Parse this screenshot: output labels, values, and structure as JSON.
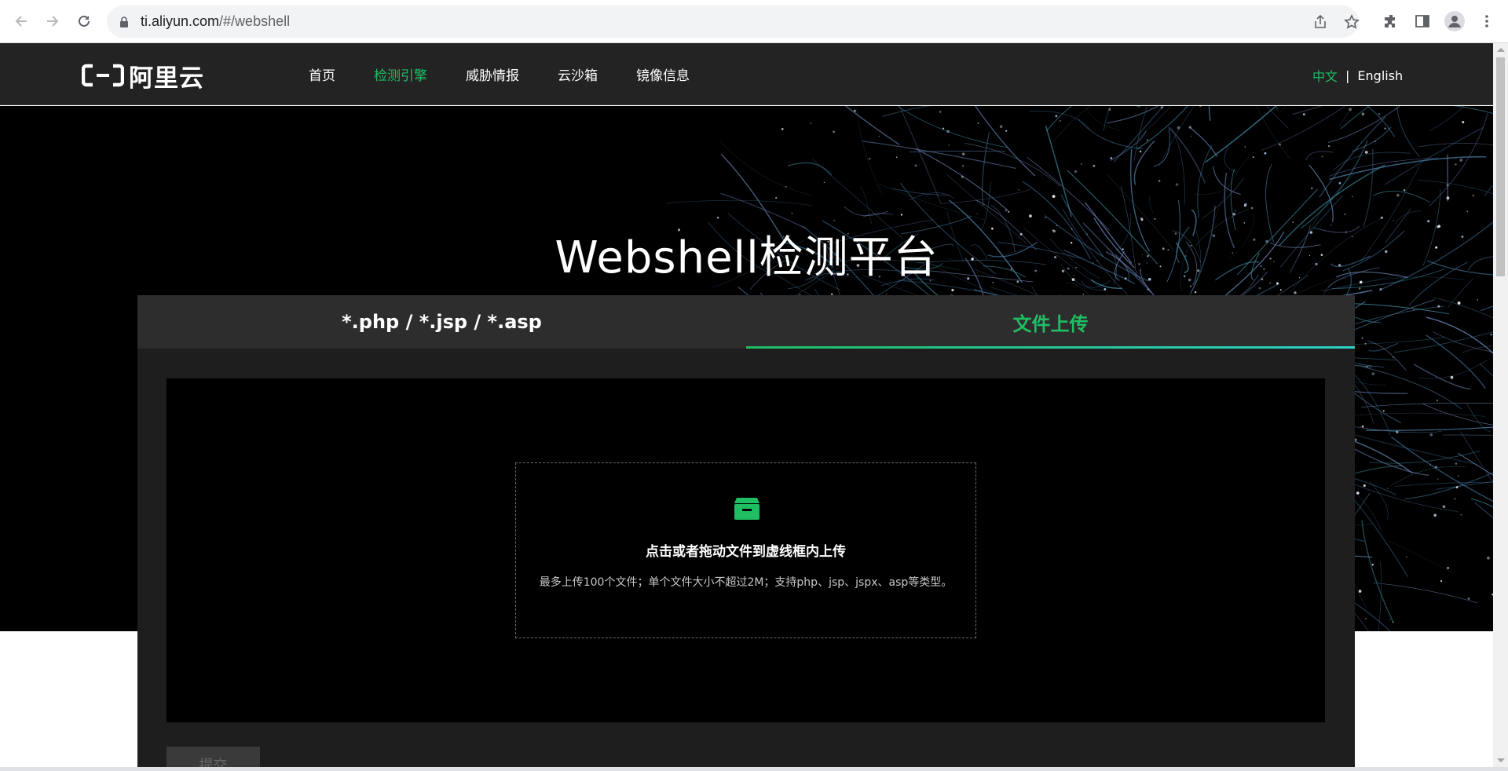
{
  "browser": {
    "url_host": "ti.aliyun.com",
    "url_path": "/#/webshell"
  },
  "site": {
    "logo_text": "阿里云",
    "nav": [
      {
        "label": "首页",
        "active": false
      },
      {
        "label": "检测引擎",
        "active": true
      },
      {
        "label": "威胁情报",
        "active": false
      },
      {
        "label": "云沙箱",
        "active": false
      },
      {
        "label": "镜像信息",
        "active": false
      }
    ],
    "lang": {
      "cn": "中文",
      "sep": "|",
      "en": "English"
    }
  },
  "hero": {
    "title": "Webshell检测平台"
  },
  "card": {
    "tabs": [
      {
        "label": "*.php / *.jsp / *.asp",
        "active": false
      },
      {
        "label": "文件上传",
        "active": true
      }
    ],
    "dropzone": {
      "title": "点击或者拖动文件到虚线框内上传",
      "hint": "最多上传100个文件；单个文件大小不超过2M；支持php、jsp、jspx、asp等类型。",
      "icon": "inbox-icon"
    },
    "submit_label": "提交"
  },
  "colors": {
    "accent": "#1fbe63",
    "header_bg": "#232323",
    "card_bg": "#1e1e1e",
    "tabs_bg": "#2d2d2d"
  }
}
